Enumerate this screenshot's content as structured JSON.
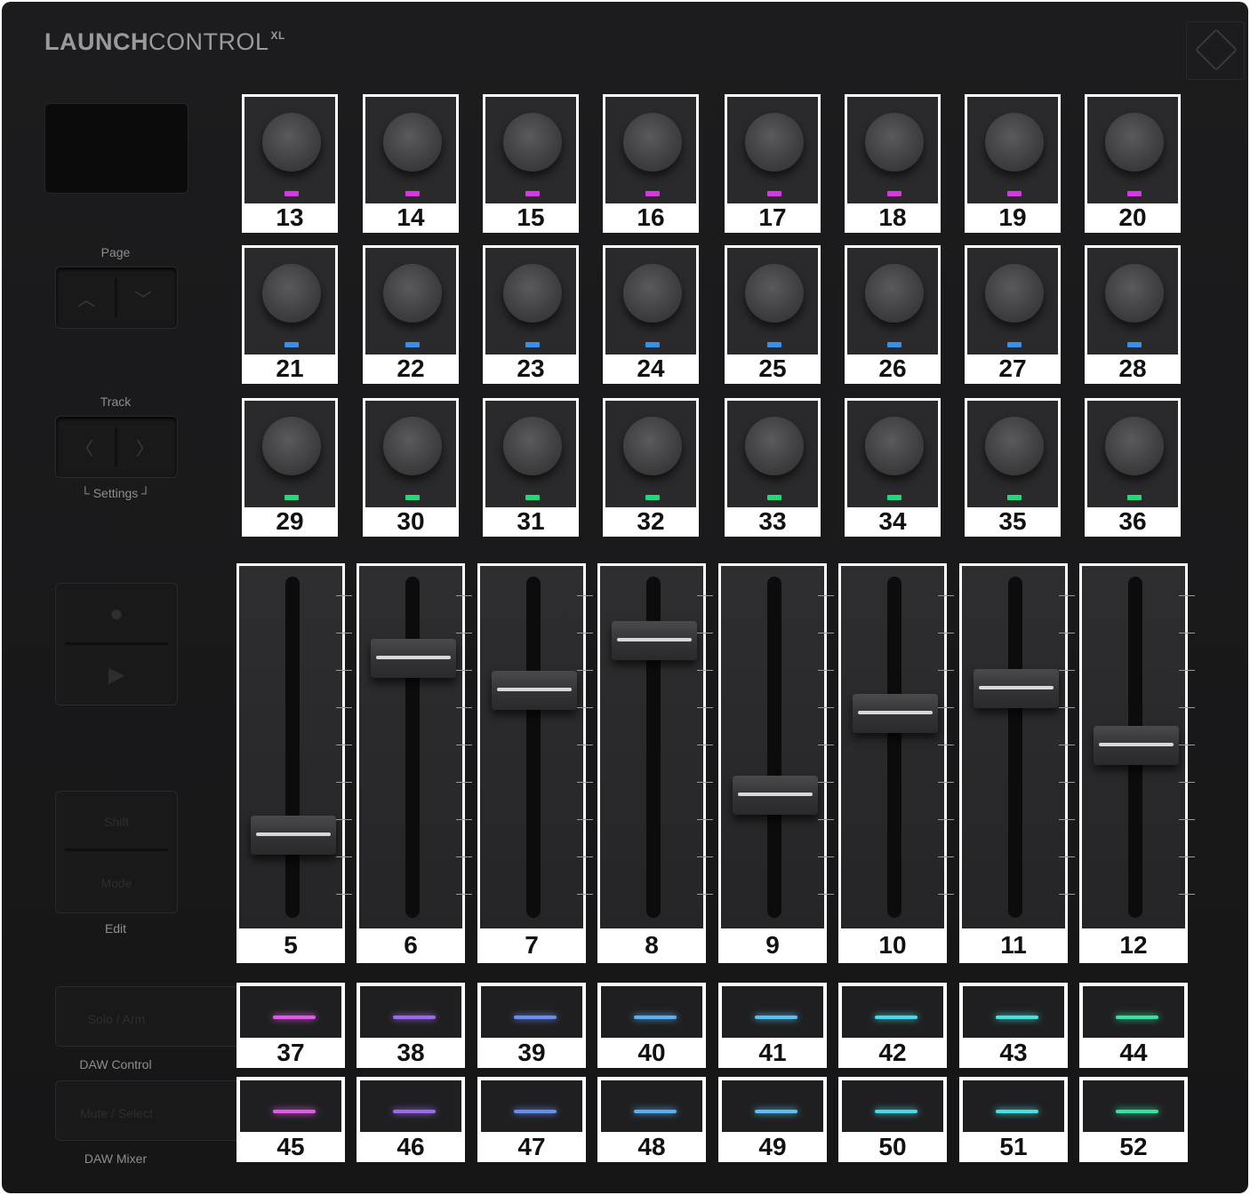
{
  "device": {
    "logo_bold": "LAUNCH",
    "logo_light": "CONTROL",
    "logo_sup": "XL"
  },
  "sidebar": {
    "page_label": "Page",
    "track_label": "Track",
    "settings_label": "└ Settings ┘",
    "shift_label": "Shift",
    "mode_label": "Mode",
    "edit_label": "Edit",
    "solo_arm_label": "Solo / Arm",
    "daw_control_label": "DAW Control",
    "mute_select_label": "Mute / Select",
    "daw_mixer_label": "DAW Mixer",
    "arrows": {
      "up": "︿",
      "down": "﹀",
      "left": "〈",
      "right": "〉"
    },
    "transport": {
      "record": "●",
      "play": "▶"
    }
  },
  "colors": {
    "knob_row1_led": "#d43ae0",
    "knob_row2_led": "#3a8fe8",
    "knob_row3_led": "#22d87a",
    "pad_leds": [
      "#e05ae8",
      "#9a6ae8",
      "#6a8ef0",
      "#5ab0f0",
      "#5ac0f0",
      "#4ad8e8",
      "#4ae0e0",
      "#3ae0a0"
    ]
  },
  "knobs": {
    "row1": [
      "13",
      "14",
      "15",
      "16",
      "17",
      "18",
      "19",
      "20"
    ],
    "row2": [
      "21",
      "22",
      "23",
      "24",
      "25",
      "26",
      "27",
      "28"
    ],
    "row3": [
      "29",
      "30",
      "31",
      "32",
      "33",
      "34",
      "35",
      "36"
    ]
  },
  "faders": [
    {
      "label": "5",
      "level": 0.14
    },
    {
      "label": "6",
      "level": 0.85
    },
    {
      "label": "7",
      "level": 0.72
    },
    {
      "label": "8",
      "level": 0.92
    },
    {
      "label": "9",
      "level": 0.3
    },
    {
      "label": "10",
      "level": 0.63
    },
    {
      "label": "11",
      "level": 0.73
    },
    {
      "label": "12",
      "level": 0.5
    }
  ],
  "pads": {
    "row1": [
      "37",
      "38",
      "39",
      "40",
      "41",
      "42",
      "43",
      "44"
    ],
    "row2": [
      "45",
      "46",
      "47",
      "48",
      "49",
      "50",
      "51",
      "52"
    ]
  }
}
